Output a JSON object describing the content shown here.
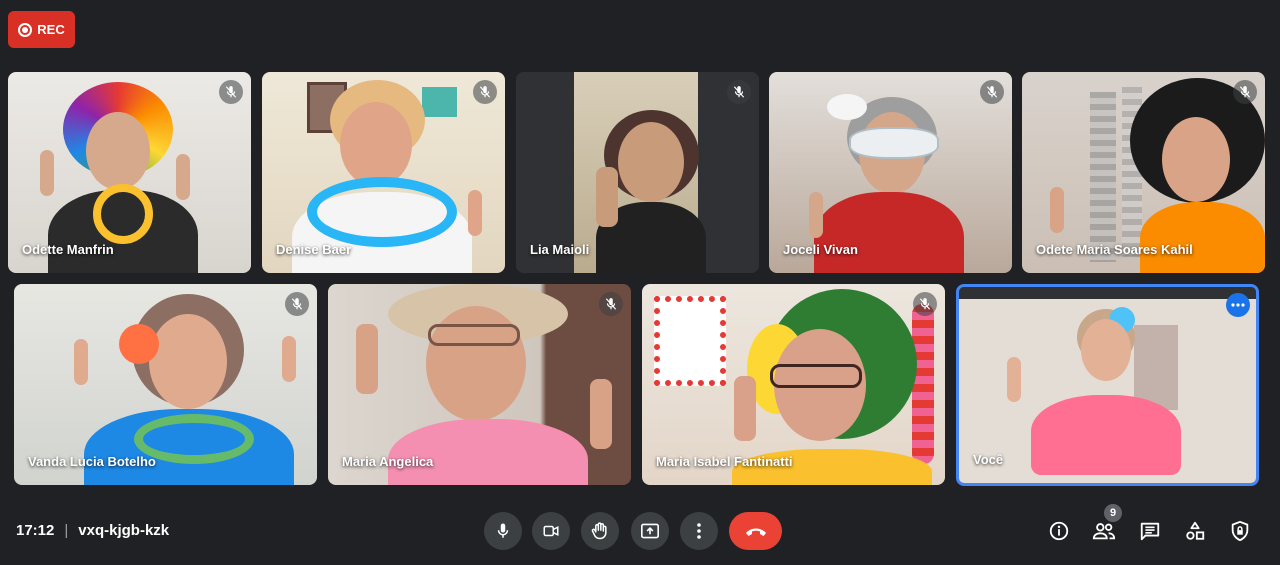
{
  "rec_label": "REC",
  "meeting": {
    "time": "17:12",
    "separator": "|",
    "code": "vxq-kjgb-kzk"
  },
  "participants": [
    {
      "name": "Odette Manfrin"
    },
    {
      "name": "Denise Baer"
    },
    {
      "name": "Lia Maioli"
    },
    {
      "name": "Joceli Vivan"
    },
    {
      "name": "Odete Maria Soares Kahil"
    },
    {
      "name": "Vanda Lucia Botelho"
    },
    {
      "name": "Maria Angelica"
    },
    {
      "name": "Maria Isabel Fantinatti"
    },
    {
      "name": "Você"
    }
  ],
  "controls": [
    "microphone-icon",
    "camera-icon",
    "raise-hand-icon",
    "present-screen-icon",
    "more-options-icon",
    "hang-up-icon"
  ],
  "side_controls": [
    "info-icon",
    "people-icon",
    "chat-icon",
    "activities-icon",
    "host-controls-icon"
  ],
  "people_count": "9",
  "colors": {
    "background": "#202124",
    "rec": "#d93025",
    "hangup": "#ea4335",
    "self_border": "#4285f4"
  }
}
